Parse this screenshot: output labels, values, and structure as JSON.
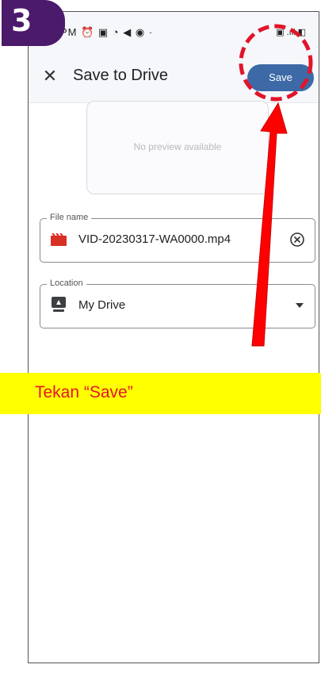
{
  "step": {
    "number": "3"
  },
  "statusbar": {
    "left_text": "PM ⏰ ▣ ◔ ◀ ◉ ·",
    "right_text": "▣ .ıll ◧"
  },
  "appbar": {
    "close_icon": "close-icon",
    "title": "Save to Drive",
    "save_label": "Save"
  },
  "preview": {
    "text": "No preview available"
  },
  "file_field": {
    "label": "File name",
    "value": "VID-20230317-WA0000.mp4",
    "icon": "video-file-icon",
    "clear_icon": "clear-icon"
  },
  "location_field": {
    "label": "Location",
    "value": "My Drive",
    "icon": "drive-icon",
    "dropdown_icon": "dropdown-icon"
  },
  "banner": {
    "text": "Tekan “Save”"
  },
  "colors": {
    "accent": "#3d6aa6",
    "banner_bg": "#ffff00",
    "banner_text": "#e2142a",
    "annotation": "#e2142a",
    "badge": "#4b1a6b"
  }
}
